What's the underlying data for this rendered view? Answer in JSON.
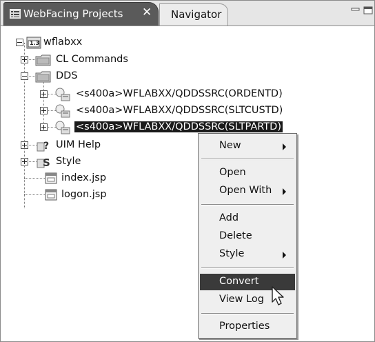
{
  "tabs": {
    "active_label": "WebFacing Projects",
    "close_glyph": "✕",
    "inactive_label": "Navigator"
  },
  "tree": {
    "root": "wflabxx",
    "cl_commands": "CL Commands",
    "dds": "DDS",
    "dds_items": [
      "<s400a>WFLABXX/QDDSSRC(ORDENTD)",
      "<s400a>WFLABXX/QDDSSRC(SLTCUSTD)",
      "<s400a>WFLABXX/QDDSSRC(SLTPARTD)"
    ],
    "uim_help": "UIM Help",
    "style": "Style",
    "index_jsp": "index.jsp",
    "logon_jsp": "logon.jsp",
    "root_badge": "1.3"
  },
  "context_menu": {
    "new": "New",
    "open": "Open",
    "open_with": "Open With",
    "add": "Add",
    "delete": "Delete",
    "style": "Style",
    "convert": "Convert",
    "view_log": "View Log",
    "properties": "Properties"
  },
  "icons": {
    "tab_icon": "view-list-icon",
    "folder": "folder-icon",
    "dds_member": "dds-member-icon",
    "help": "help-icon",
    "style": "style-icon",
    "jsp": "jsp-file-icon",
    "cursor": "mouse-pointer-icon"
  }
}
